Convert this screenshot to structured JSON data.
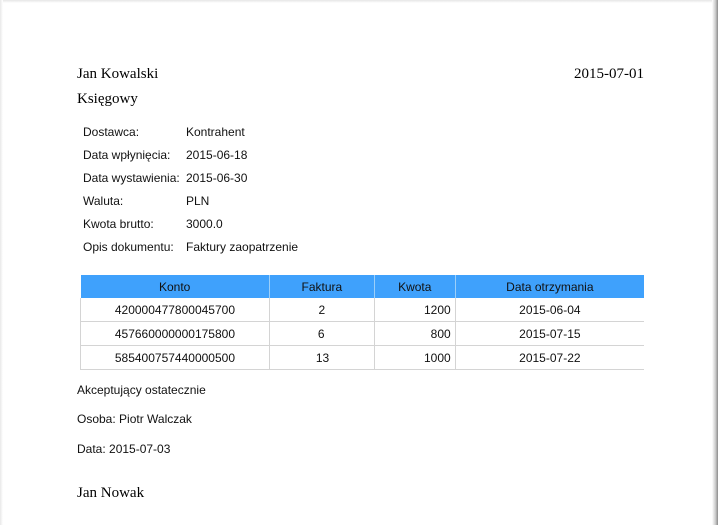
{
  "header": {
    "name": "Jan Kowalski",
    "role": "Księgowy",
    "date": "2015-07-01"
  },
  "info": [
    {
      "label": "Dostawca:",
      "value": "Kontrahent"
    },
    {
      "label": "Data wpłynięcia:",
      "value": "2015-06-18"
    },
    {
      "label": "Data wystawienia:",
      "value": "2015-06-30"
    },
    {
      "label": "Waluta:",
      "value": "PLN"
    },
    {
      "label": "Kwota brutto:",
      "value": "3000.0"
    },
    {
      "label": "Opis dokumentu:",
      "value": "Faktury zaopatrzenie"
    }
  ],
  "table": {
    "columns": [
      "Konto",
      "Faktura",
      "Kwota",
      "Data otrzymania"
    ],
    "rows": [
      [
        "420000477800045700",
        "2",
        "1200",
        "2015-06-04"
      ],
      [
        "457660000000175800",
        "6",
        "800",
        "2015-07-15"
      ],
      [
        "585400757440000500",
        "13",
        "1000",
        "2015-07-22"
      ]
    ]
  },
  "acceptance": {
    "title": "Akceptujący ostatecznie",
    "person": "Osoba: Piotr Walczak",
    "date": "Data: 2015-07-03"
  },
  "signature": "Jan Nowak",
  "colors": {
    "table_header": "#3fa1fc"
  }
}
